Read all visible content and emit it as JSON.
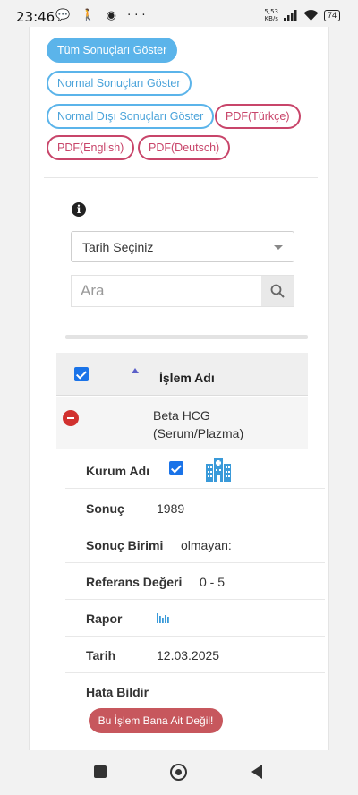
{
  "status_bar": {
    "time": "23:46",
    "left_icons": "💬 🚶 ◉ ···",
    "speed_value": "5,53",
    "speed_unit": "KB/s",
    "battery": "74"
  },
  "filters": {
    "all_results": "Tüm Sonuçları Göster",
    "normal_results": "Normal Sonuçları Göster",
    "abnormal_results": "Normal Dışı Sonuçları Göster",
    "pdf_tr": "PDF(Türkçe)",
    "pdf_en": "PDF(English)",
    "pdf_de": "PDF(Deutsch)"
  },
  "date_select": {
    "value": "Tarih Seçiniz"
  },
  "search": {
    "placeholder": "Ara"
  },
  "table": {
    "header": "İşlem Adı",
    "row_title_line1": "Beta HCG",
    "row_title_line2": "(Serum/Plazma)"
  },
  "details": {
    "institution_label": "Kurum Adı",
    "result_label": "Sonuç",
    "result_value": "1989",
    "unit_label": "Sonuç Birimi",
    "unit_value": "olmayan:",
    "reference_label": "Referans Değeri",
    "reference_value": "0 - 5",
    "report_label": "Rapor",
    "date_label": "Tarih",
    "date_value": "12.03.2025",
    "report_error_label": "Hata Bildir",
    "error_button": "Bu İşlem Bana Ait Değil!"
  },
  "colors": {
    "primary_blue": "#5bb4ea",
    "pdf_red": "#c8456a",
    "error_button": "#c7575d",
    "checkbox_blue": "#1a73e8"
  }
}
